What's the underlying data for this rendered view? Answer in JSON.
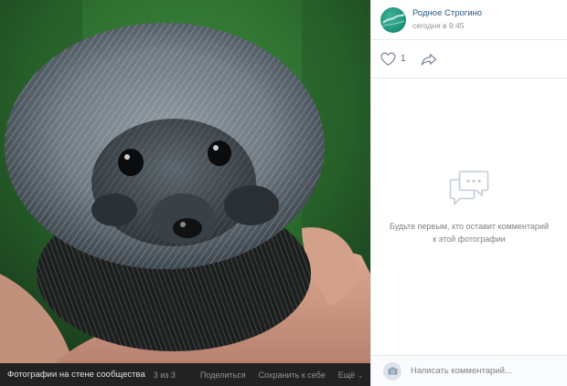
{
  "photo": {
    "subject": "hedgehog held in palm"
  },
  "photo_bar": {
    "album_title": "Фотографии на стене сообщества",
    "counter": "3 из 3",
    "share_label": "Поделиться",
    "save_label": "Сохранить к себе",
    "more_label": "Ещё"
  },
  "post": {
    "community_name": "Родное Строгино",
    "time": "сегодня в 9:45",
    "likes": "1"
  },
  "comments": {
    "empty_text": "Будьте первым, кто оставит комментарий к этой фотографии",
    "input_placeholder": "Написать комментарий..."
  },
  "icons": {
    "like": "heart-icon",
    "share": "share-arrow-icon",
    "empty": "speech-bubbles-icon",
    "camera": "camera-icon",
    "more": "chevron-down-icon"
  },
  "colors": {
    "link": "#2a5885",
    "muted": "#939393",
    "accent_green": "#1d8f77"
  }
}
